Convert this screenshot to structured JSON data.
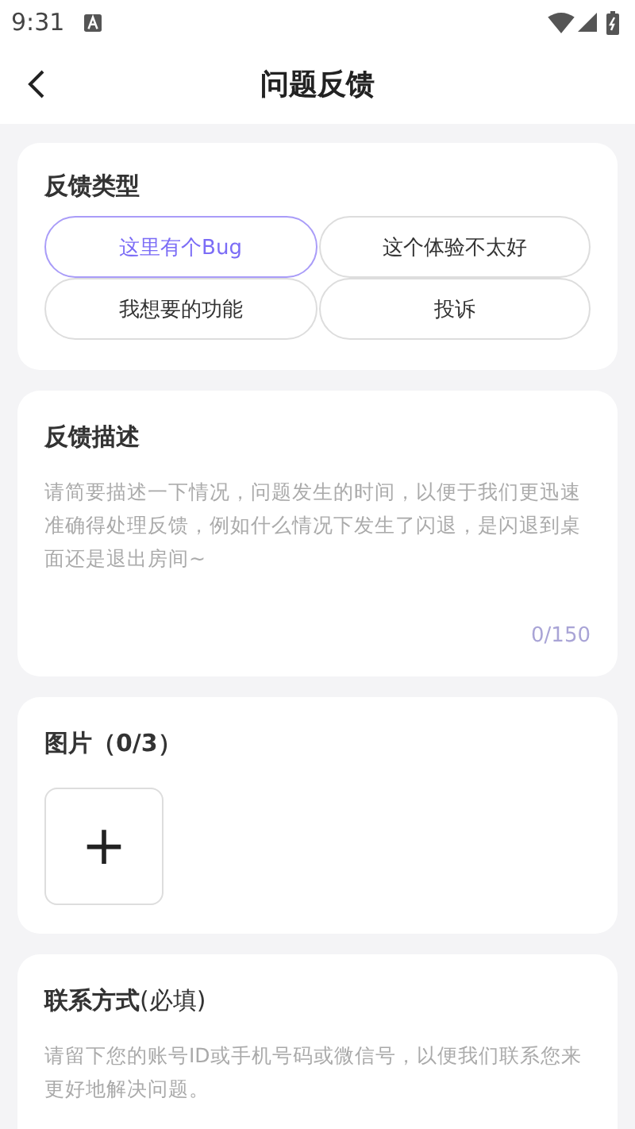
{
  "status_bar": {
    "time": "9:31"
  },
  "header": {
    "title": "问题反馈"
  },
  "feedback_type": {
    "title": "反馈类型",
    "options": [
      {
        "label": "这里有个Bug",
        "selected": true
      },
      {
        "label": "这个体验不太好",
        "selected": false
      },
      {
        "label": "我想要的功能",
        "selected": false
      },
      {
        "label": "投诉",
        "selected": false
      }
    ]
  },
  "description": {
    "title": "反馈描述",
    "placeholder": "请简要描述一下情况，问题发生的时间，以便于我们更迅速准确得处理反馈，例如什么情况下发生了闪退，是闪退到桌面还是退出房间~",
    "counter": "0/150"
  },
  "images": {
    "title": "图片（0/3）",
    "add_symbol": "+"
  },
  "contact": {
    "title": "**联系方式**(必填)",
    "placeholder": "请留下您的账号ID或手机号码或微信号，以便我们联系您来更好地解决问题。"
  }
}
